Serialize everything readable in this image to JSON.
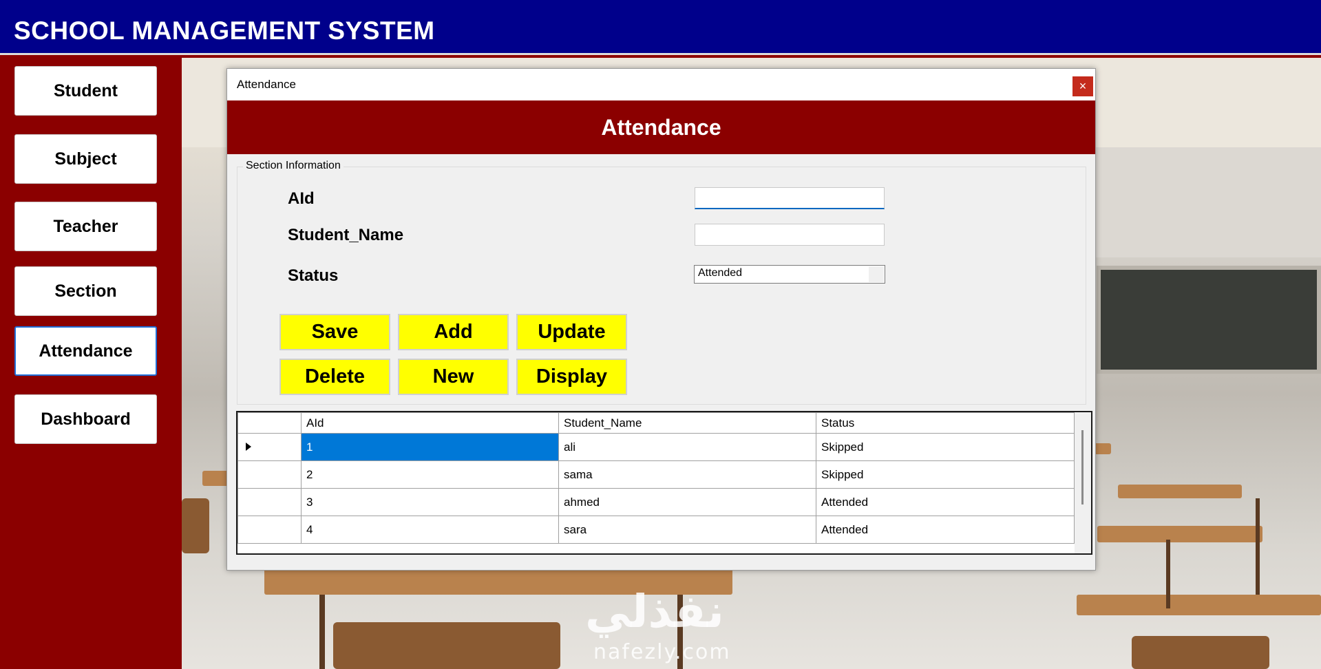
{
  "app": {
    "title": "SCHOOL MANAGEMENT SYSTEM"
  },
  "sidebar": {
    "items": [
      {
        "label": "Student"
      },
      {
        "label": "Subject"
      },
      {
        "label": "Teacher"
      },
      {
        "label": "Section"
      },
      {
        "label": "Attendance",
        "active": true
      },
      {
        "label": "Dashboard"
      }
    ]
  },
  "dialog": {
    "window_title": "Attendance",
    "close_glyph": "×",
    "header": "Attendance",
    "group_title": "Section Information",
    "fields": {
      "aid_label": "AId",
      "aid_value": "",
      "name_label": "Student_Name",
      "name_value": "",
      "status_label": "Status",
      "status_value": "Attended"
    },
    "buttons": {
      "save": "Save",
      "add": "Add",
      "update": "Update",
      "delete": "Delete",
      "new": "New",
      "display": "Display"
    },
    "grid": {
      "columns": [
        "AId",
        "Student_Name",
        "Status"
      ],
      "rows": [
        [
          "1",
          "ali",
          "Skipped"
        ],
        [
          "2",
          "sama",
          "Skipped"
        ],
        [
          "3",
          "ahmed",
          "Attended"
        ],
        [
          "4",
          "sara",
          "Attended"
        ]
      ]
    }
  },
  "watermark": {
    "text": "nafezly.com",
    "arabic": "نفذلي"
  },
  "colors": {
    "titlebar": "#00008b",
    "sidebar": "#8b0000",
    "dialog_header": "#8b0000",
    "button_yellow": "#ffff00",
    "selection_blue": "#0078d7"
  }
}
